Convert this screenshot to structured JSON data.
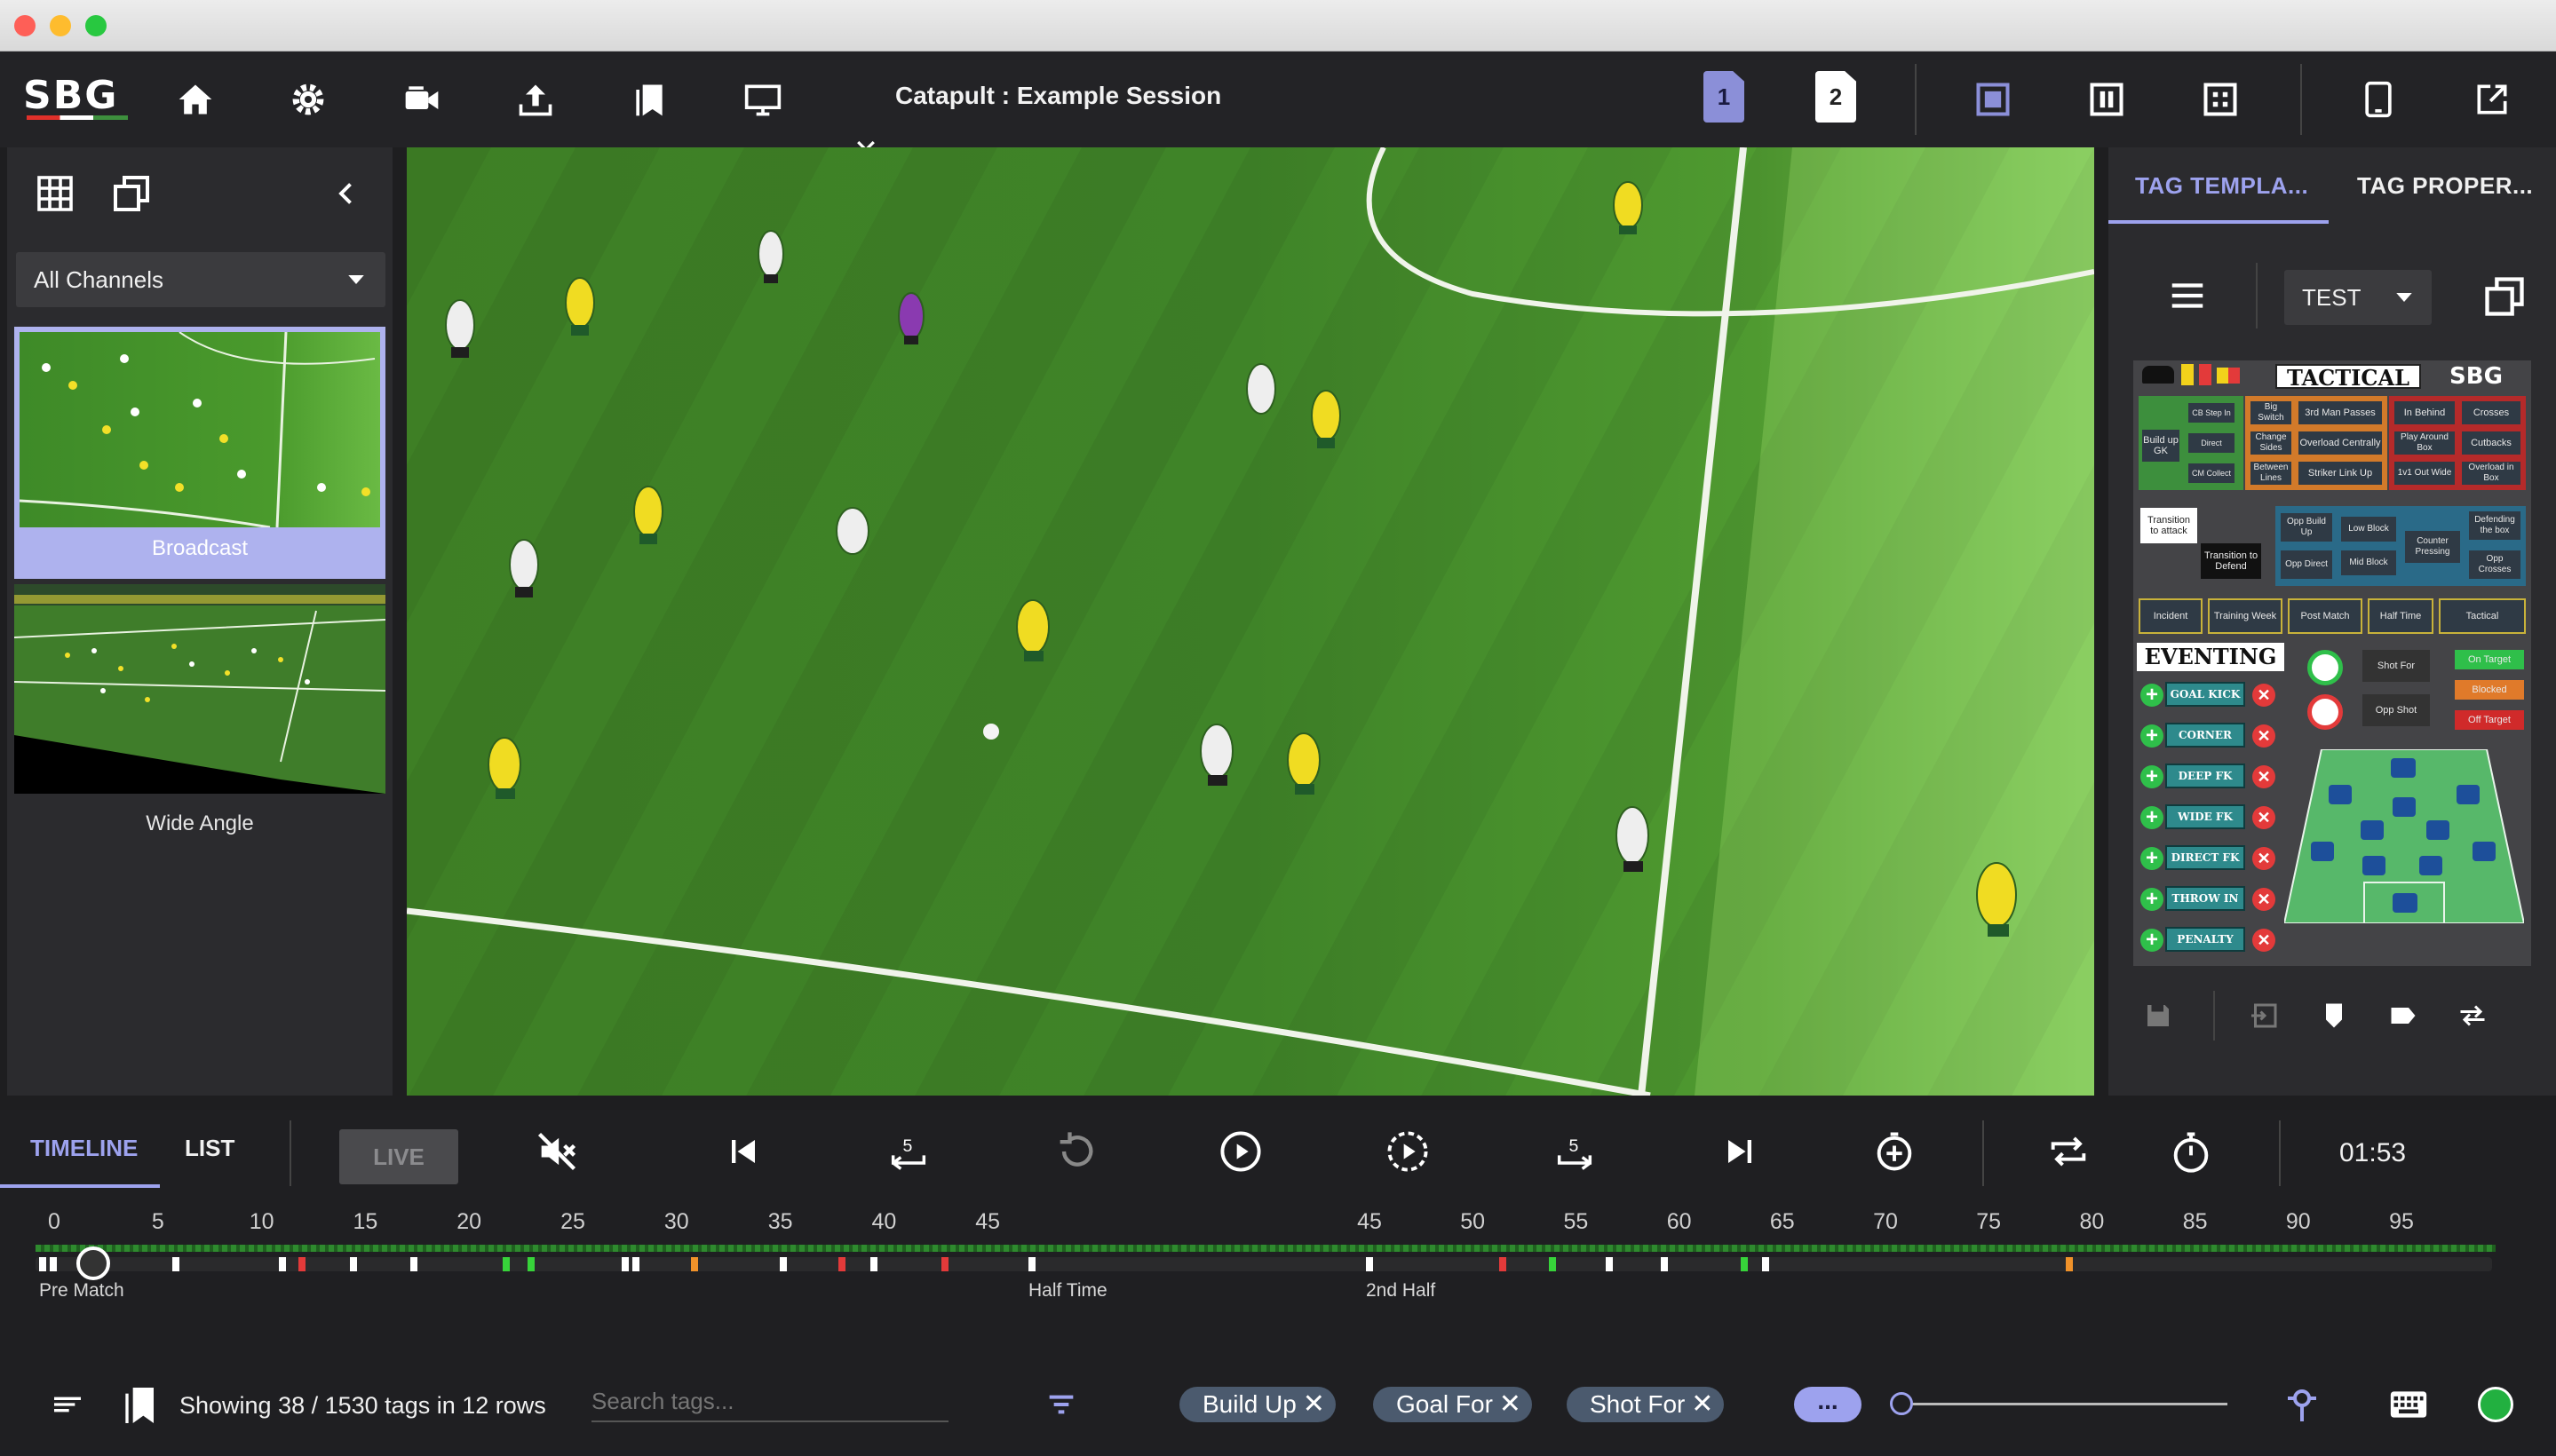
{
  "window": {
    "title": ""
  },
  "toolbar": {
    "logo": "SBG",
    "session_title": "Catapult : Example Session",
    "icons": [
      "home-icon",
      "gear-icon",
      "camera-icon",
      "upload-icon",
      "bookmarks-icon",
      "monitor-icon"
    ],
    "view_pages": [
      "1",
      "2"
    ],
    "accent": "#7b7fc9"
  },
  "channels": {
    "select_value": "All Channels",
    "items": [
      {
        "label": "Broadcast",
        "selected": true
      },
      {
        "label": "Wide Angle",
        "selected": false
      }
    ]
  },
  "right_panel": {
    "tabs": [
      {
        "label": "TAG TEMPLA...",
        "active": true
      },
      {
        "label": "TAG PROPER...",
        "active": false
      }
    ],
    "template_select": "TEST",
    "board": {
      "tactical_title": "TACTICAL",
      "brand": "SBG",
      "build_up": {
        "main": "Build up GK",
        "subs": [
          "CB Step In",
          "Direct",
          "CM Collect"
        ]
      },
      "grid1": [
        "Big Switch",
        "3rd Man Passes",
        "Change Sides",
        "Overload Centrally",
        "Between Lines",
        "Striker Link Up"
      ],
      "grid2": [
        "In Behind",
        "Crosses",
        "Play Around Box",
        "Cutbacks",
        "1v1 Out Wide",
        "Overload in Box"
      ],
      "transition_attack": "Transition to attack",
      "transition_defend": "Transition to Defend",
      "defend": [
        "Opp Build Up",
        "Low Block",
        "Defending the box",
        "Counter Pressing",
        "Opp Direct",
        "Mid Block",
        "Opp Crosses"
      ],
      "periods": [
        "Incident",
        "Training Week",
        "Post Match",
        "Half Time",
        "Tactical"
      ],
      "eventing_title": "EVENTING",
      "events": [
        "GOAL KICK",
        "CORNER",
        "DEEP FK",
        "WIDE FK",
        "DIRECT FK",
        "THROW IN",
        "PENALTY"
      ],
      "shots": [
        "Shot For",
        "Opp Shot"
      ],
      "outcomes": [
        "On Target",
        "Blocked",
        "Off Target"
      ]
    }
  },
  "timeline": {
    "tabs": [
      {
        "label": "TIMELINE",
        "active": true
      },
      {
        "label": "LIST",
        "active": false
      }
    ],
    "live_label": "LIVE",
    "clock": "01:53",
    "ticks_first": [
      "0",
      "5",
      "10",
      "15",
      "20",
      "25",
      "30",
      "35",
      "40",
      "45"
    ],
    "ticks_second": [
      "45",
      "50",
      "55",
      "60",
      "65",
      "70",
      "75",
      "80",
      "85",
      "90",
      "95"
    ],
    "markers": [
      {
        "label": "Pre Match"
      },
      {
        "label": "Half Time"
      },
      {
        "label": "2nd Half"
      }
    ],
    "status": "Showing 38 / 1530 tags in 12 rows",
    "search_placeholder": "Search tags...",
    "filters": [
      "Build Up",
      "Goal For",
      "Shot For"
    ],
    "more": "...",
    "colors": {
      "green": "#37d33a",
      "red": "#e33a3a",
      "orange": "#f0922a",
      "white": "#ffffff"
    }
  }
}
